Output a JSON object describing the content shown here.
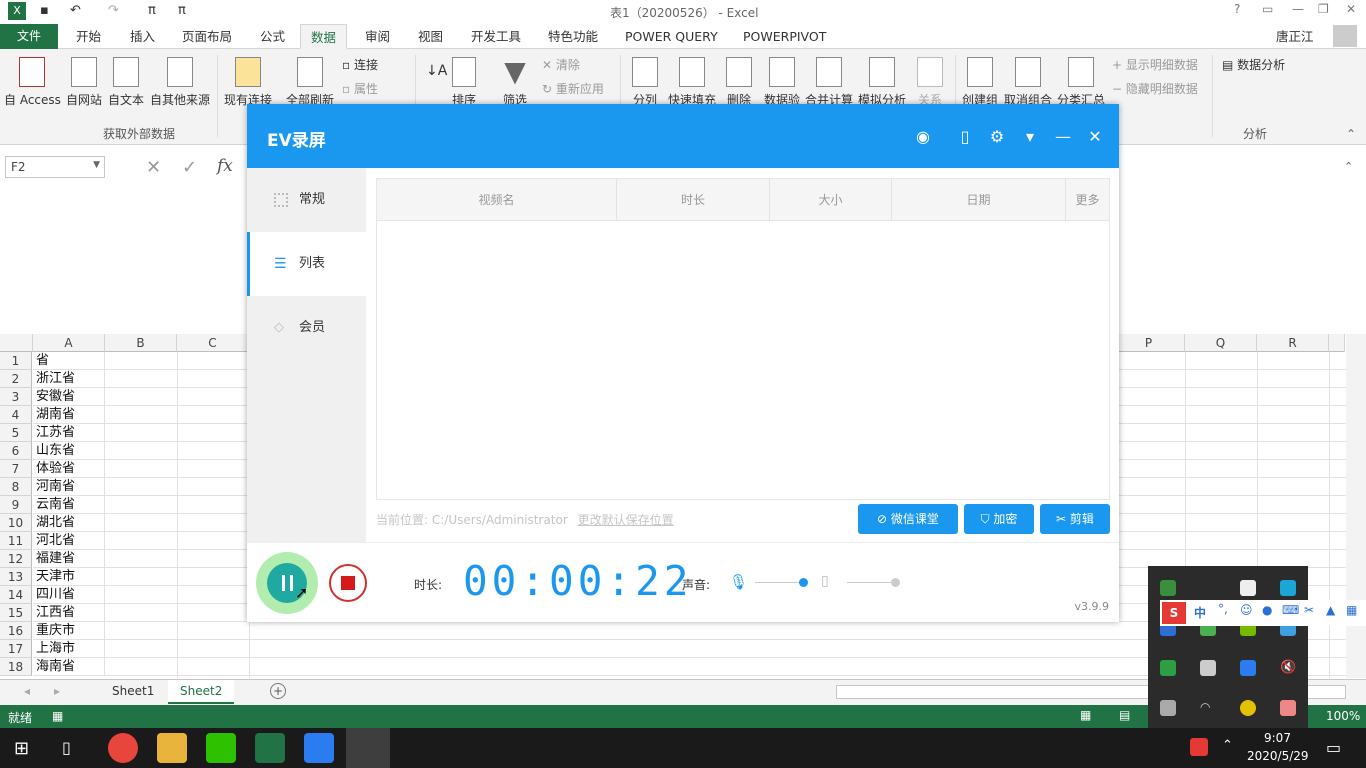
{
  "excel": {
    "title": "表1（20200526） - Excel",
    "user": "唐正江",
    "file_tab": "文件",
    "tabs": [
      "开始",
      "插入",
      "页面布局",
      "公式",
      "数据",
      "审阅",
      "视图",
      "开发工具",
      "特色功能",
      "POWER QUERY",
      "POWERPIVOT"
    ],
    "active_tab": "数据",
    "ribbon": {
      "get_external": [
        "自 Access",
        "自网站",
        "自文本",
        "自其他来源"
      ],
      "get_external_group": "获取外部数据",
      "existing_conn": "现有连接",
      "refresh_all": "全部刷新",
      "conn_small": [
        "连接",
        "属性"
      ],
      "sort": "排序",
      "filter": "筛选",
      "filter_small": [
        "清除",
        "重新应用"
      ],
      "tools": [
        "分列",
        "快速填充",
        "删除",
        "数据验",
        "合并计算",
        "模拟分析",
        "关系"
      ],
      "outline": [
        "创建组",
        "取消组合",
        "分类汇总"
      ],
      "outline_small": [
        "显示明细数据",
        "隐藏明细数据"
      ],
      "analysis": "数据分析",
      "analysis_group": "分析"
    },
    "namebox": "F2",
    "fx": "fx",
    "columns": [
      "A",
      "B",
      "C"
    ],
    "columns_right": [
      "P",
      "Q",
      "R"
    ],
    "rows": [
      "1",
      "2",
      "3",
      "4",
      "5",
      "6",
      "7",
      "8",
      "9",
      "10",
      "11",
      "12",
      "13",
      "14",
      "15",
      "16",
      "17",
      "18"
    ],
    "cells": [
      "省",
      "浙江省",
      "安徽省",
      "湖南省",
      "江苏省",
      "山东省",
      "体验省",
      "河南省",
      "云南省",
      "湖北省",
      "河北省",
      "福建省",
      "天津市",
      "四川省",
      "江西省",
      "重庆市",
      "上海市",
      "海南省"
    ],
    "sheets": [
      "Sheet1",
      "Sheet2"
    ],
    "active_sheet": "Sheet2",
    "status": "就绪",
    "zoom": "100%"
  },
  "ev": {
    "title": "EV录屏",
    "side": [
      "常规",
      "列表",
      "会员"
    ],
    "active_side": "列表",
    "columns": [
      "视频名",
      "时长",
      "大小",
      "日期",
      "更多"
    ],
    "path_label": "当前位置: C:/Users/Administrator",
    "path_change": "更改默认保存位置",
    "buttons": [
      "微信课堂",
      "加密",
      "剪辑"
    ],
    "duration_label": "时长:",
    "timer": "00:00:22",
    "volume_label": "声音:",
    "version": "v3.9.9",
    "accent": "#1a98f0"
  },
  "taskbar": {
    "time": "9:07",
    "date": "2020/5/29",
    "ime": "中"
  }
}
